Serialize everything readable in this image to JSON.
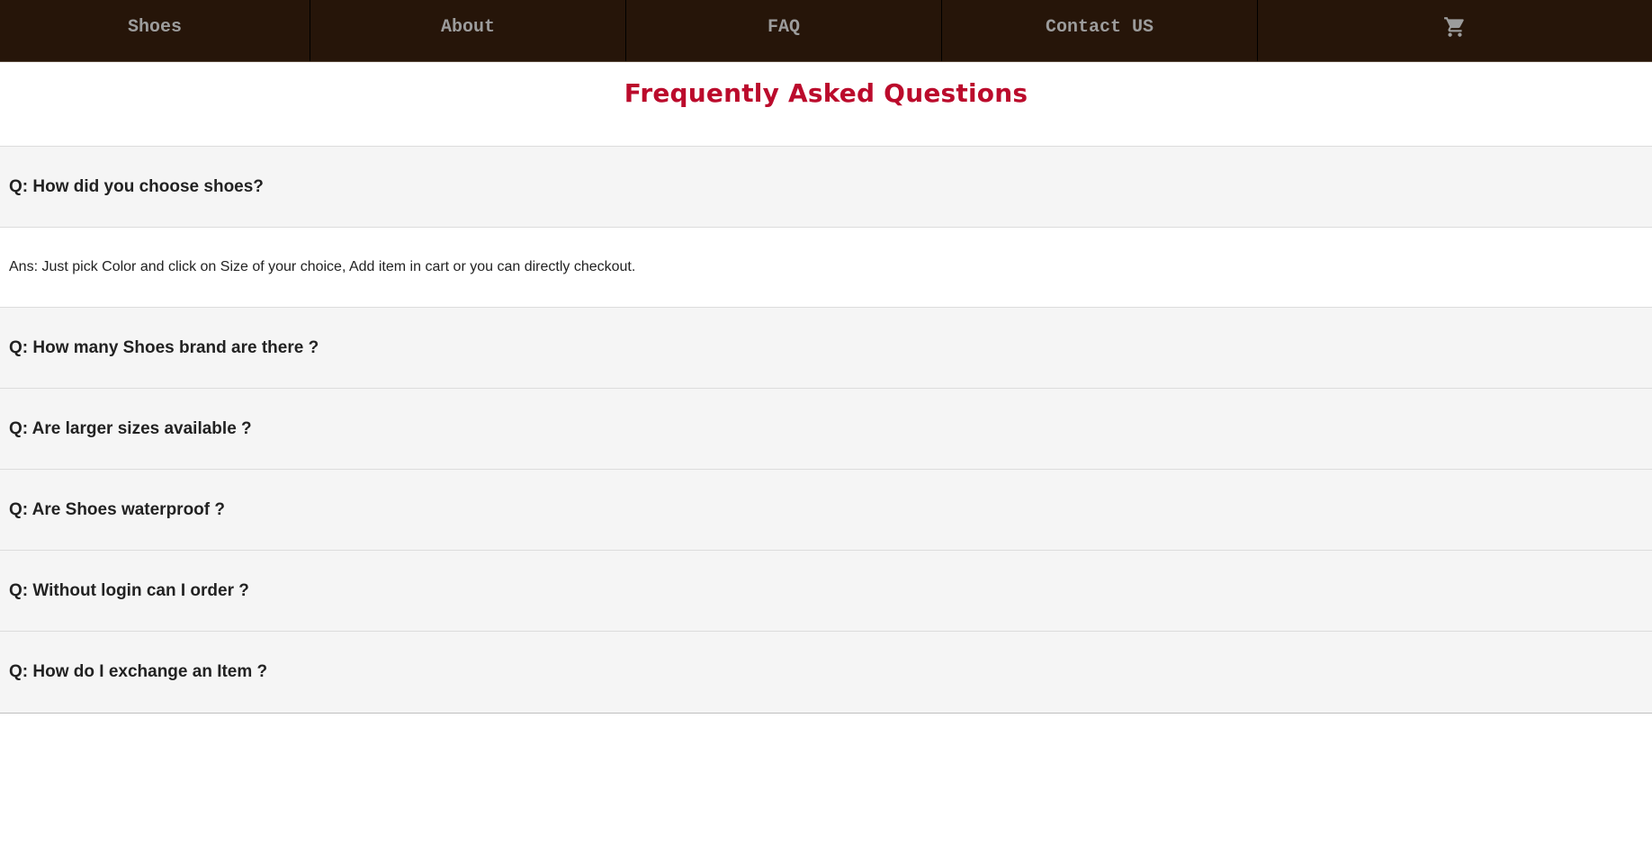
{
  "nav": {
    "items": [
      {
        "label": "Shoes"
      },
      {
        "label": "About"
      },
      {
        "label": "FAQ"
      },
      {
        "label": "Contact US"
      }
    ],
    "cart_icon": "shopping-cart-icon",
    "background": "#261509",
    "text_color": "#9c9c9c"
  },
  "page": {
    "title": "Frequently Asked Questions",
    "title_color": "#bb0b2c"
  },
  "faq": {
    "items": [
      {
        "question": "Q: How did you choose shoes?",
        "answer": "Ans: Just pick Color and click on Size of your choice, Add item in cart or you can directly checkout.",
        "expanded": true
      },
      {
        "question": "Q: How many Shoes brand are there ?",
        "expanded": false
      },
      {
        "question": "Q: Are larger sizes available ?",
        "expanded": false
      },
      {
        "question": "Q: Are Shoes waterproof ?",
        "expanded": false
      },
      {
        "question": "Q: Without login can I order ?",
        "expanded": false
      },
      {
        "question": "Q: How do I exchange an Item ?",
        "expanded": false
      }
    ]
  }
}
